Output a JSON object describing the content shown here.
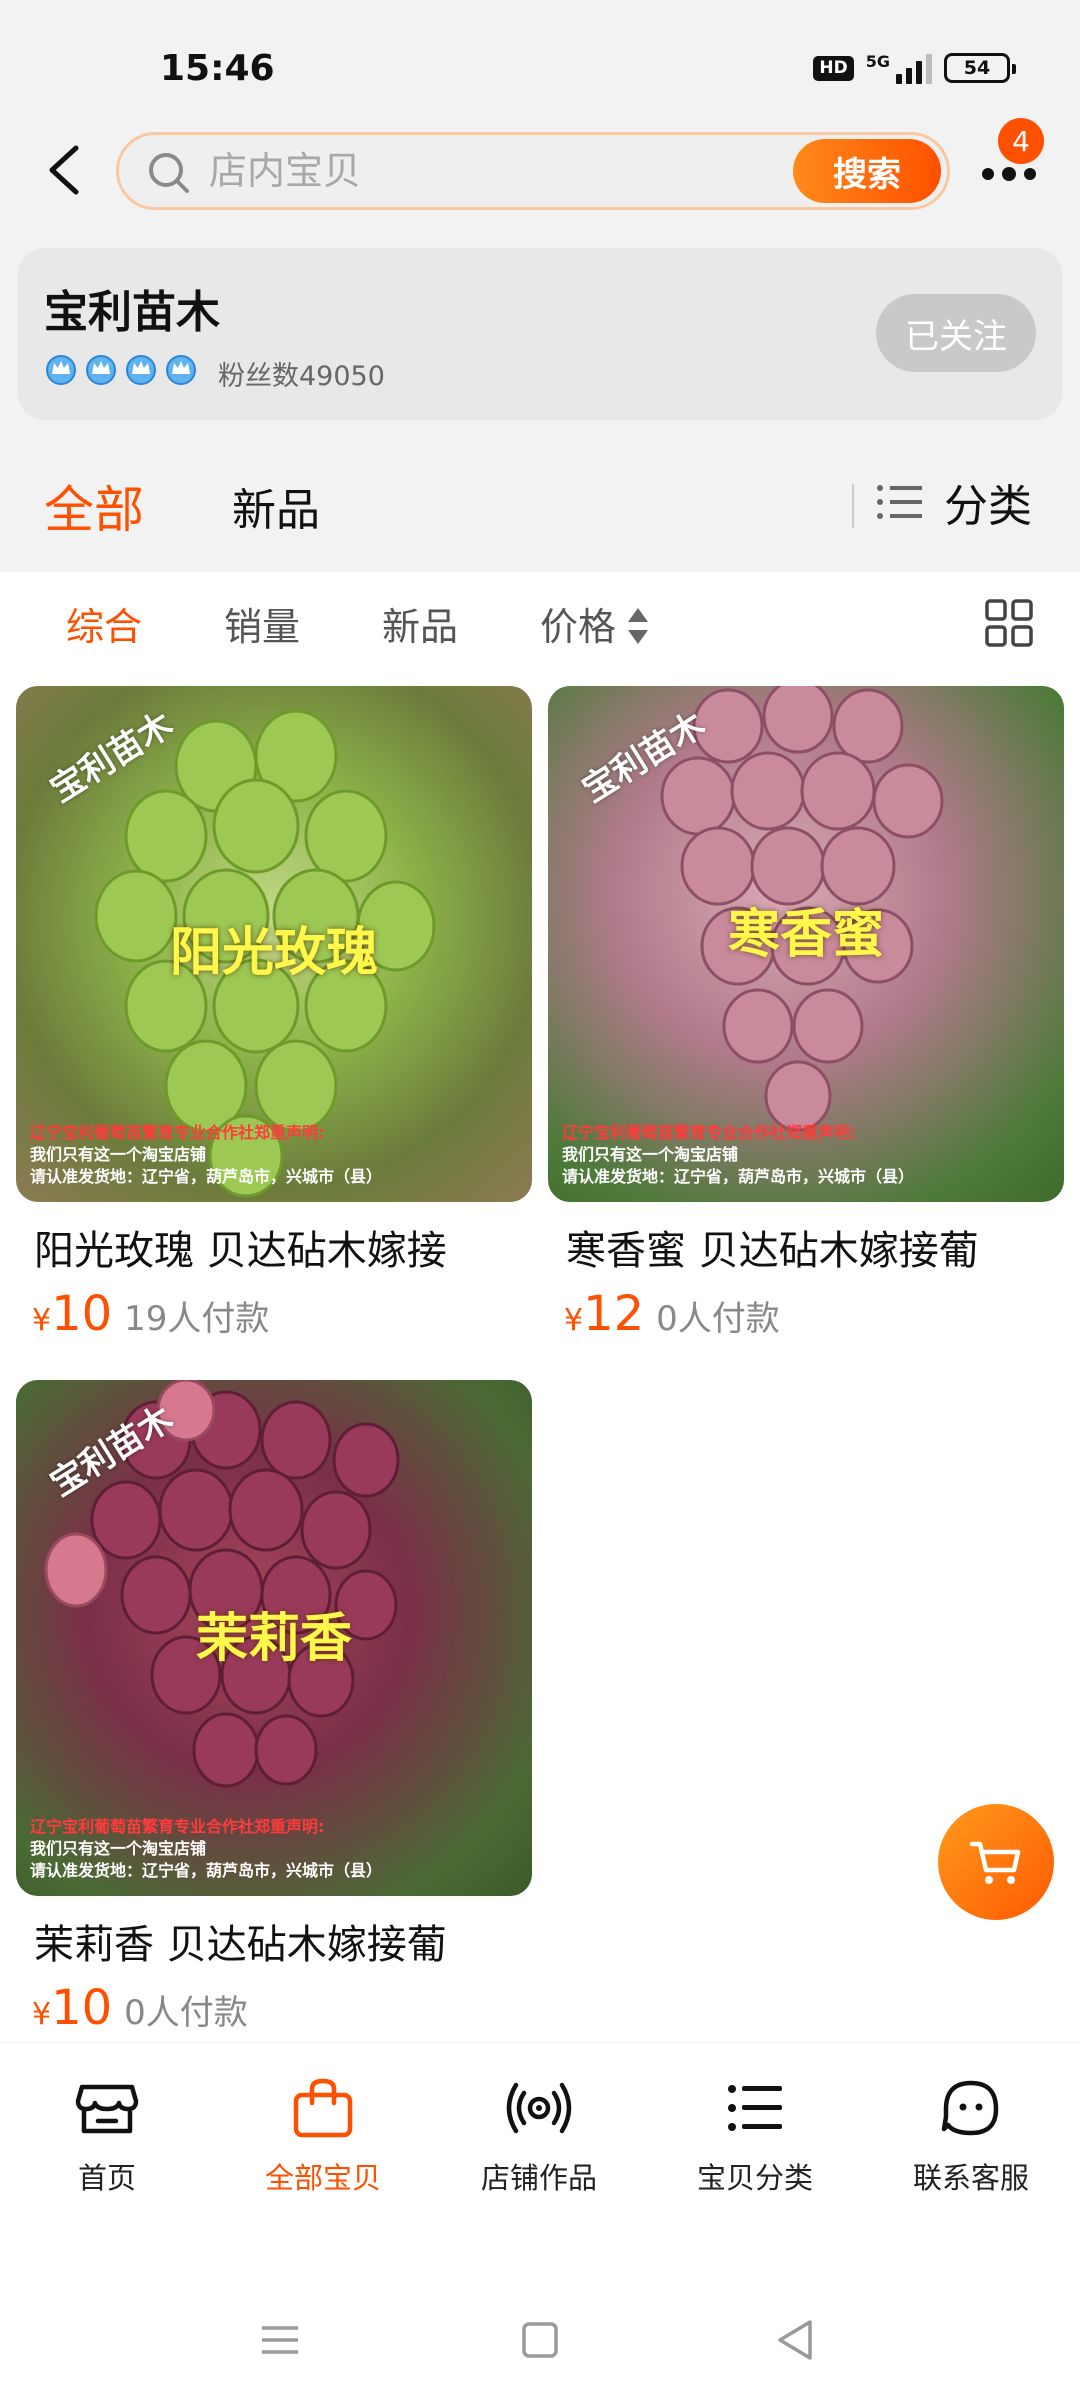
{
  "status_bar": {
    "time": "15:46",
    "hd": "HD",
    "network": "5G",
    "battery": "54"
  },
  "search": {
    "placeholder": "店内宝贝",
    "button_label": "搜索",
    "notification_count": "4"
  },
  "store": {
    "name": "宝利苗木",
    "fans": "粉丝数49050",
    "follow_label": "已关注",
    "rating_icons": [
      "crown-icon",
      "crown-icon",
      "crown-icon",
      "crown-icon"
    ]
  },
  "main_tabs": {
    "all": "全部",
    "new": "新品",
    "category": "分类"
  },
  "sort_bar": {
    "items": [
      "综合",
      "销量",
      "新品",
      "价格"
    ],
    "active": "综合"
  },
  "products": [
    {
      "title": "阳光玫瑰 贝达砧木嫁接",
      "currency": "¥",
      "price": "10",
      "sold": "19人付款",
      "image_label": "阳光玫瑰",
      "watermark": "宝利苗木",
      "notice": [
        "辽宁宝利葡萄苗繁育专业合作社郑重声明:",
        "我们只有这一个淘宝店铺",
        "请认准发货地：辽宁省，葫芦岛市，兴城市（县）"
      ]
    },
    {
      "title": "寒香蜜 贝达砧木嫁接葡",
      "currency": "¥",
      "price": "12",
      "sold": "0人付款",
      "image_label": "寒香蜜",
      "watermark": "宝利苗木",
      "notice": [
        "辽宁宝利葡萄苗繁育专业合作社郑重声明:",
        "我们只有这一个淘宝店铺",
        "请认准发货地：辽宁省，葫芦岛市，兴城市（县）"
      ]
    },
    {
      "title": "茉莉香 贝达砧木嫁接葡",
      "currency": "¥",
      "price": "10",
      "sold": "0人付款",
      "image_label": "茉莉香",
      "watermark": "宝利苗木",
      "notice": [
        "辽宁宝利葡萄苗繁育专业合作社郑重声明:",
        "我们只有这一个淘宝店铺",
        "请认准发货地：辽宁省，葫芦岛市，兴城市（县）"
      ]
    }
  ],
  "bottom_nav": [
    {
      "label": "首页",
      "icon": "store-icon"
    },
    {
      "label": "全部宝贝",
      "icon": "bag-icon"
    },
    {
      "label": "店铺作品",
      "icon": "broadcast-icon"
    },
    {
      "label": "宝贝分类",
      "icon": "list-icon"
    },
    {
      "label": "联系客服",
      "icon": "service-icon"
    }
  ],
  "colors": {
    "accent": "#ff5000",
    "background": "#f2f2f2",
    "price": "#ff5000"
  }
}
